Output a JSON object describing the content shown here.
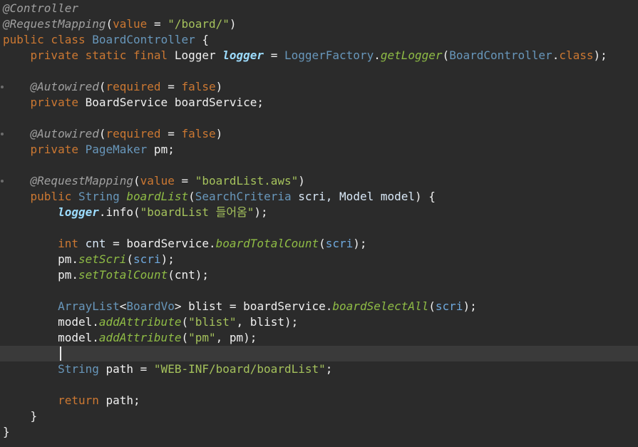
{
  "editor": {
    "lines": [
      {
        "tokens": [
          {
            "t": "@Controller",
            "c": "ann"
          }
        ]
      },
      {
        "tokens": [
          {
            "t": "@RequestMapping",
            "c": "ann"
          },
          {
            "t": "(",
            "c": "plain"
          },
          {
            "t": "value",
            "c": "kw"
          },
          {
            "t": " = ",
            "c": "plain"
          },
          {
            "t": "\"/board/\"",
            "c": "str"
          },
          {
            "t": ")",
            "c": "plain"
          }
        ]
      },
      {
        "tokens": [
          {
            "t": "public class ",
            "c": "kw"
          },
          {
            "t": "BoardController",
            "c": "typ"
          },
          {
            "t": " {",
            "c": "plain"
          }
        ]
      },
      {
        "tokens": [
          {
            "t": "    private static final ",
            "c": "kw"
          },
          {
            "t": "Logger ",
            "c": "plain"
          },
          {
            "t": "logger",
            "c": "fld"
          },
          {
            "t": " = ",
            "c": "plain"
          },
          {
            "t": "LoggerFactory",
            "c": "typ"
          },
          {
            "t": ".",
            "c": "plain"
          },
          {
            "t": "getLogger",
            "c": "mth"
          },
          {
            "t": "(",
            "c": "plain"
          },
          {
            "t": "BoardController",
            "c": "typ"
          },
          {
            "t": ".",
            "c": "plain"
          },
          {
            "t": "class",
            "c": "kw"
          },
          {
            "t": ");",
            "c": "plain"
          }
        ]
      },
      {
        "tokens": []
      },
      {
        "marker": true,
        "tokens": [
          {
            "t": "    @Autowired",
            "c": "ann"
          },
          {
            "t": "(",
            "c": "plain"
          },
          {
            "t": "required",
            "c": "kw"
          },
          {
            "t": " = ",
            "c": "plain"
          },
          {
            "t": "false",
            "c": "kw"
          },
          {
            "t": ")",
            "c": "plain"
          }
        ]
      },
      {
        "tokens": [
          {
            "t": "    private ",
            "c": "kw"
          },
          {
            "t": "BoardService boardService;",
            "c": "plain"
          }
        ]
      },
      {
        "tokens": []
      },
      {
        "marker": true,
        "tokens": [
          {
            "t": "    @Autowired",
            "c": "ann"
          },
          {
            "t": "(",
            "c": "plain"
          },
          {
            "t": "required",
            "c": "kw"
          },
          {
            "t": " = ",
            "c": "plain"
          },
          {
            "t": "false",
            "c": "kw"
          },
          {
            "t": ")",
            "c": "plain"
          }
        ]
      },
      {
        "tokens": [
          {
            "t": "    private ",
            "c": "kw"
          },
          {
            "t": "PageMaker",
            "c": "typ"
          },
          {
            "t": " pm;",
            "c": "plain"
          }
        ]
      },
      {
        "tokens": []
      },
      {
        "marker": true,
        "tokens": [
          {
            "t": "    @RequestMapping",
            "c": "ann"
          },
          {
            "t": "(",
            "c": "plain"
          },
          {
            "t": "value",
            "c": "kw"
          },
          {
            "t": " = ",
            "c": "plain"
          },
          {
            "t": "\"boardList.aws\"",
            "c": "str"
          },
          {
            "t": ")",
            "c": "plain"
          }
        ]
      },
      {
        "tokens": [
          {
            "t": "    public ",
            "c": "kw"
          },
          {
            "t": "String",
            "c": "typ"
          },
          {
            "t": " ",
            "c": "plain"
          },
          {
            "t": "boardList",
            "c": "mth"
          },
          {
            "t": "(",
            "c": "plain"
          },
          {
            "t": "SearchCriteria",
            "c": "typ"
          },
          {
            "t": " scri, ",
            "c": "var"
          },
          {
            "t": "Model model",
            "c": "var"
          },
          {
            "t": ") {",
            "c": "plain"
          }
        ]
      },
      {
        "tokens": [
          {
            "t": "        ",
            "c": "plain"
          },
          {
            "t": "logger",
            "c": "fld"
          },
          {
            "t": ".info(",
            "c": "plain"
          },
          {
            "t": "\"boardList 들어옴\"",
            "c": "str"
          },
          {
            "t": ");",
            "c": "plain"
          }
        ]
      },
      {
        "tokens": []
      },
      {
        "tokens": [
          {
            "t": "        int ",
            "c": "kw"
          },
          {
            "t": "cnt",
            "c": "var"
          },
          {
            "t": " = boardService.",
            "c": "plain"
          },
          {
            "t": "boardTotalCount",
            "c": "mth"
          },
          {
            "t": "(",
            "c": "plain"
          },
          {
            "t": "scri",
            "c": "par"
          },
          {
            "t": ");",
            "c": "plain"
          }
        ]
      },
      {
        "tokens": [
          {
            "t": "        pm.",
            "c": "plain"
          },
          {
            "t": "setScri",
            "c": "mth"
          },
          {
            "t": "(",
            "c": "plain"
          },
          {
            "t": "scri",
            "c": "par"
          },
          {
            "t": ");",
            "c": "plain"
          }
        ]
      },
      {
        "tokens": [
          {
            "t": "        pm.",
            "c": "plain"
          },
          {
            "t": "setTotalCount",
            "c": "mth"
          },
          {
            "t": "(cnt);",
            "c": "plain"
          }
        ]
      },
      {
        "tokens": []
      },
      {
        "tokens": [
          {
            "t": "        ArrayList",
            "c": "typ"
          },
          {
            "t": "<",
            "c": "plain"
          },
          {
            "t": "BoardVo",
            "c": "typ"
          },
          {
            "t": "> blist = boardService.",
            "c": "plain"
          },
          {
            "t": "boardSelectAll",
            "c": "mth"
          },
          {
            "t": "(",
            "c": "plain"
          },
          {
            "t": "scri",
            "c": "par"
          },
          {
            "t": ");",
            "c": "plain"
          }
        ]
      },
      {
        "tokens": [
          {
            "t": "        model.",
            "c": "plain"
          },
          {
            "t": "addAttribute",
            "c": "mth"
          },
          {
            "t": "(",
            "c": "plain"
          },
          {
            "t": "\"blist\"",
            "c": "str"
          },
          {
            "t": ", blist);",
            "c": "plain"
          }
        ]
      },
      {
        "tokens": [
          {
            "t": "        model.",
            "c": "plain"
          },
          {
            "t": "addAttribute",
            "c": "mth"
          },
          {
            "t": "(",
            "c": "plain"
          },
          {
            "t": "\"pm\"",
            "c": "str"
          },
          {
            "t": ", pm);",
            "c": "plain"
          }
        ]
      },
      {
        "current": true,
        "tokens": []
      },
      {
        "tokens": [
          {
            "t": "        String",
            "c": "typ"
          },
          {
            "t": " path = ",
            "c": "plain"
          },
          {
            "t": "\"WEB-INF/board/boardList\"",
            "c": "str"
          },
          {
            "t": ";",
            "c": "plain"
          }
        ]
      },
      {
        "tokens": []
      },
      {
        "tokens": [
          {
            "t": "        return ",
            "c": "kw"
          },
          {
            "t": "path;",
            "c": "plain"
          }
        ]
      },
      {
        "tokens": [
          {
            "t": "    }",
            "c": "plain"
          }
        ]
      },
      {
        "tokens": [
          {
            "t": "}",
            "c": "plain"
          }
        ]
      }
    ]
  }
}
